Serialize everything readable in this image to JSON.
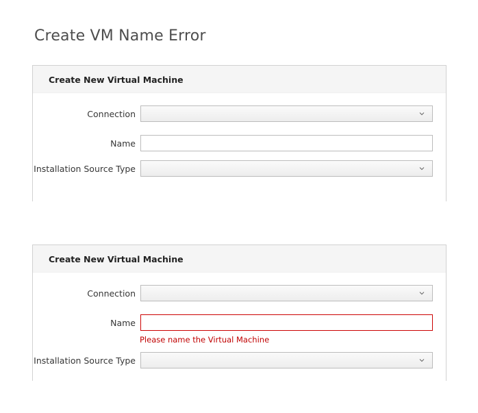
{
  "page": {
    "title": "Create VM Name Error"
  },
  "form_normal": {
    "header": "Create New Virtual Machine",
    "connection_label": "Connection",
    "connection_value": "",
    "name_label": "Name",
    "name_value": "",
    "source_type_label": "Installation Source Type",
    "source_type_value": ""
  },
  "form_error": {
    "header": "Create New Virtual Machine",
    "connection_label": "Connection",
    "connection_value": "",
    "name_label": "Name",
    "name_value": "",
    "name_error": "Please name the Virtual Machine",
    "source_type_label": "Installation Source Type",
    "source_type_value": ""
  },
  "icons": {
    "dropdown": "chevron-down-icon"
  },
  "colors": {
    "error": "#c00000",
    "error_border": "#cc0000",
    "header_bg": "#f5f5f5",
    "border": "#bbbbbb"
  }
}
